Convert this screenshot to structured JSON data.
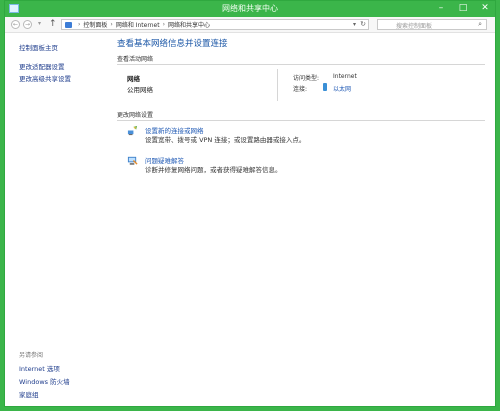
{
  "window": {
    "title": "网络和共享中心",
    "controls": [
      "–",
      "□",
      "✕"
    ]
  },
  "nav": {
    "back": "←",
    "forward": "→",
    "up": "↑",
    "breadcrumbs": [
      "控制面板",
      "网络和 Internet",
      "网络和共享中心"
    ],
    "search_placeholder": "搜索控制面板"
  },
  "sidebar": {
    "links": [
      "控制面板主页",
      "更改适配器设置",
      "更改高级共享设置"
    ],
    "see_also_heading": "另请参阅",
    "see_also": [
      "Internet 选项",
      "Windows 防火墙",
      "家庭组"
    ]
  },
  "main": {
    "title": "查看基本网络信息并设置连接",
    "active_label": "查看活动网络",
    "network_name": "网络",
    "network_type": "公用网络",
    "access_type_label": "访问类型:",
    "access_type_value": "Internet",
    "connection_label": "连接:",
    "connection_value": "以太网",
    "change_label": "更改网络设置",
    "tasks": [
      {
        "link": "设置新的连接或网络",
        "desc": "设置宽带、拨号或 VPN 连接；或设置路由器或接入点。"
      },
      {
        "link": "问题疑难解答",
        "desc": "诊断并修复网络问题，或者获得疑难解答信息。"
      }
    ]
  }
}
